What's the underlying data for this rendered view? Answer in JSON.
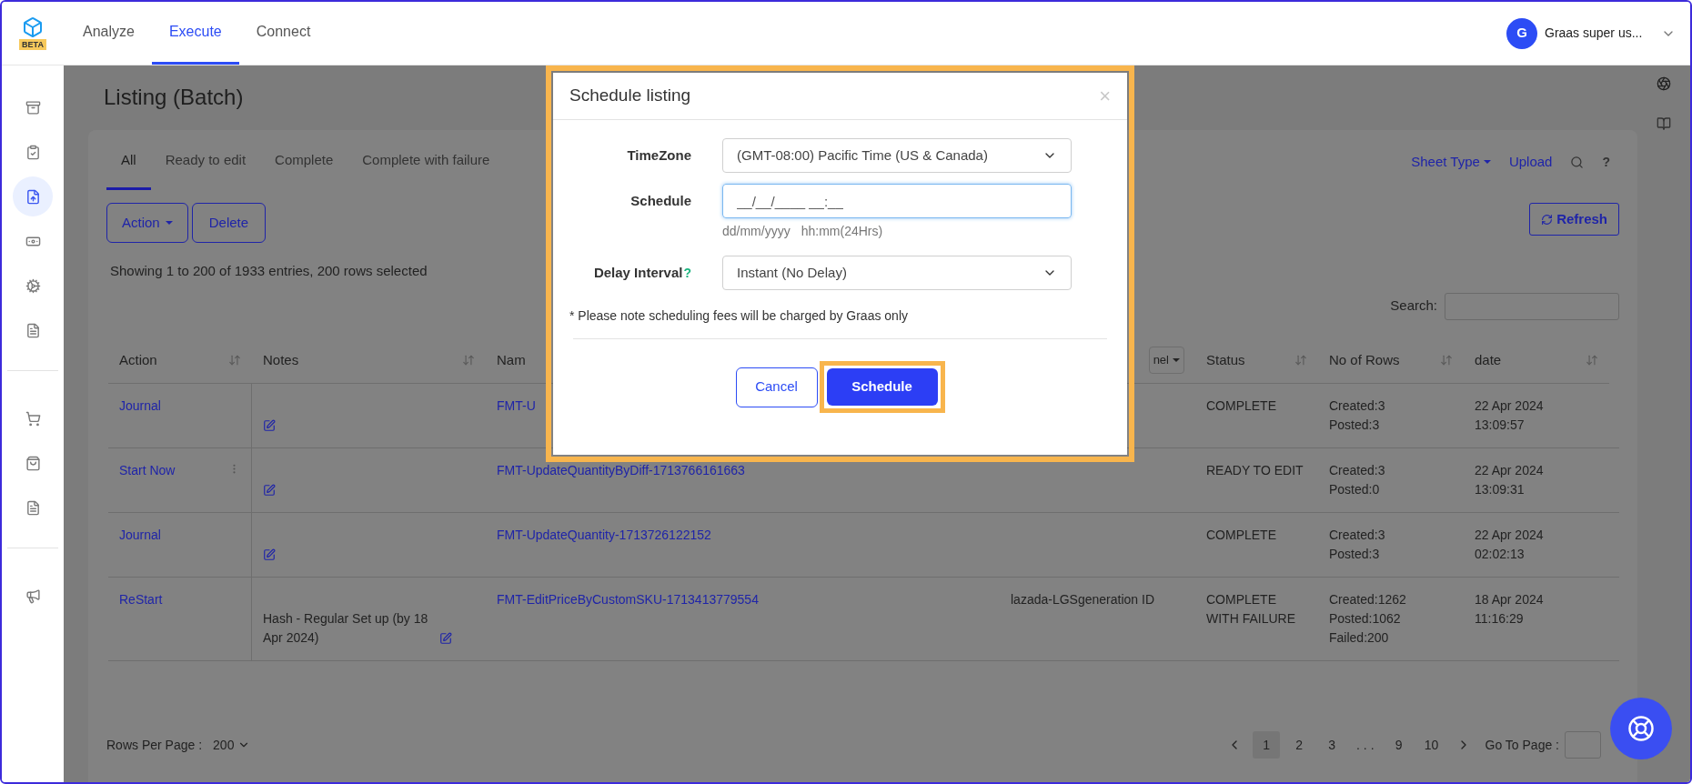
{
  "topbar": {
    "logo_badge": "BETA",
    "nav": [
      {
        "label": "Analyze",
        "selected": false
      },
      {
        "label": "Execute",
        "selected": true
      },
      {
        "label": "Connect",
        "selected": false
      }
    ],
    "user": {
      "initial": "G",
      "name": "Graas super us..."
    }
  },
  "sidebar": {
    "groups": [
      [
        {
          "selected": false
        },
        {
          "selected": false
        },
        {
          "selected": true
        },
        {
          "selected": false
        },
        {
          "selected": false
        },
        {
          "selected": false
        }
      ],
      [
        {
          "selected": false
        },
        {
          "selected": false
        },
        {
          "selected": false
        }
      ],
      [
        {
          "selected": false
        }
      ]
    ]
  },
  "page": {
    "title": "Listing (Batch)"
  },
  "tabs": [
    {
      "label": "All",
      "selected": true
    },
    {
      "label": "Ready to edit",
      "selected": false
    },
    {
      "label": "Complete",
      "selected": false
    },
    {
      "label": "Complete with failure",
      "selected": false
    }
  ],
  "toolbar": {
    "sheet_type": "Sheet Type",
    "upload": "Upload",
    "help": "?",
    "action": "Action",
    "delete": "Delete",
    "refresh": "Refresh"
  },
  "summary": "Showing 1 to 200 of 1933 entries, 200 rows selected",
  "search": {
    "label": "Search:"
  },
  "table": {
    "columns": [
      {
        "label": "Action",
        "kind": "sort"
      },
      {
        "label": "Notes",
        "kind": "sort"
      },
      {
        "label": "Nam",
        "kind": "plain"
      },
      {
        "label": "nel",
        "kind": "dropdown"
      },
      {
        "label": "Status",
        "kind": "sort"
      },
      {
        "label": "No of Rows",
        "kind": "sort"
      },
      {
        "label": "date",
        "kind": "sort"
      }
    ],
    "rows": [
      {
        "action": "Journal",
        "menu": false,
        "notes": "",
        "name": "FMT-U",
        "channel": "",
        "status": "COMPLETE",
        "counts": [
          "Created:3",
          "Posted:3"
        ],
        "date": [
          "22 Apr 2024",
          "13:09:57"
        ]
      },
      {
        "action": "Start Now",
        "menu": true,
        "notes": "",
        "name": "FMT-UpdateQuantityByDiff-1713766161663",
        "channel": "",
        "status": "READY TO EDIT",
        "counts": [
          "Created:3",
          "Posted:0"
        ],
        "date": [
          "22 Apr 2024",
          "13:09:31"
        ]
      },
      {
        "action": "Journal",
        "menu": false,
        "notes": "",
        "name": "FMT-UpdateQuantity-1713726122152",
        "channel": "",
        "status": "COMPLETE",
        "counts": [
          "Created:3",
          "Posted:3"
        ],
        "date": [
          "22 Apr 2024",
          "02:02:13"
        ]
      },
      {
        "action": "ReStart",
        "menu": false,
        "notes": "Hash - Regular Set up (by 18 Apr 2024)",
        "name": "FMT-EditPriceByCustomSKU-1713413779554",
        "channel": "lazada-LGSgeneration ID",
        "status": "COMPLETE WITH FAILURE",
        "counts": [
          "Created:1262",
          "Posted:1062",
          "Failed:200"
        ],
        "date": [
          "18 Apr 2024",
          "11:16:29"
        ]
      }
    ]
  },
  "footer": {
    "rows_label": "Rows Per Page :",
    "rows_value": "200",
    "pages": [
      {
        "label": "1",
        "selected": true
      },
      {
        "label": "2",
        "selected": false
      },
      {
        "label": "3",
        "selected": false
      },
      {
        "label": ". . .",
        "selected": false
      },
      {
        "label": "9",
        "selected": false
      },
      {
        "label": "10",
        "selected": false
      }
    ],
    "goto_label": "Go To Page :"
  },
  "modal": {
    "title": "Schedule listing",
    "close": "×",
    "fields": [
      {
        "label": "TimeZone",
        "kind": "select",
        "value": "(GMT-08:00) Pacific Time (US & Canada)",
        "help": false
      },
      {
        "label": "Schedule",
        "kind": "input",
        "placeholder": "__/__/____ __:__",
        "focused": true,
        "hints": [
          "dd/mm/yyyy",
          "hh:mm(24Hrs)"
        ],
        "help": false
      },
      {
        "label": "Delay Interval",
        "kind": "select",
        "value": "Instant (No Delay)",
        "help": true,
        "help_mark": "?"
      }
    ],
    "note": "* Please note scheduling fees will be charged by Graas only",
    "cancel": "Cancel",
    "submit": "Schedule"
  }
}
